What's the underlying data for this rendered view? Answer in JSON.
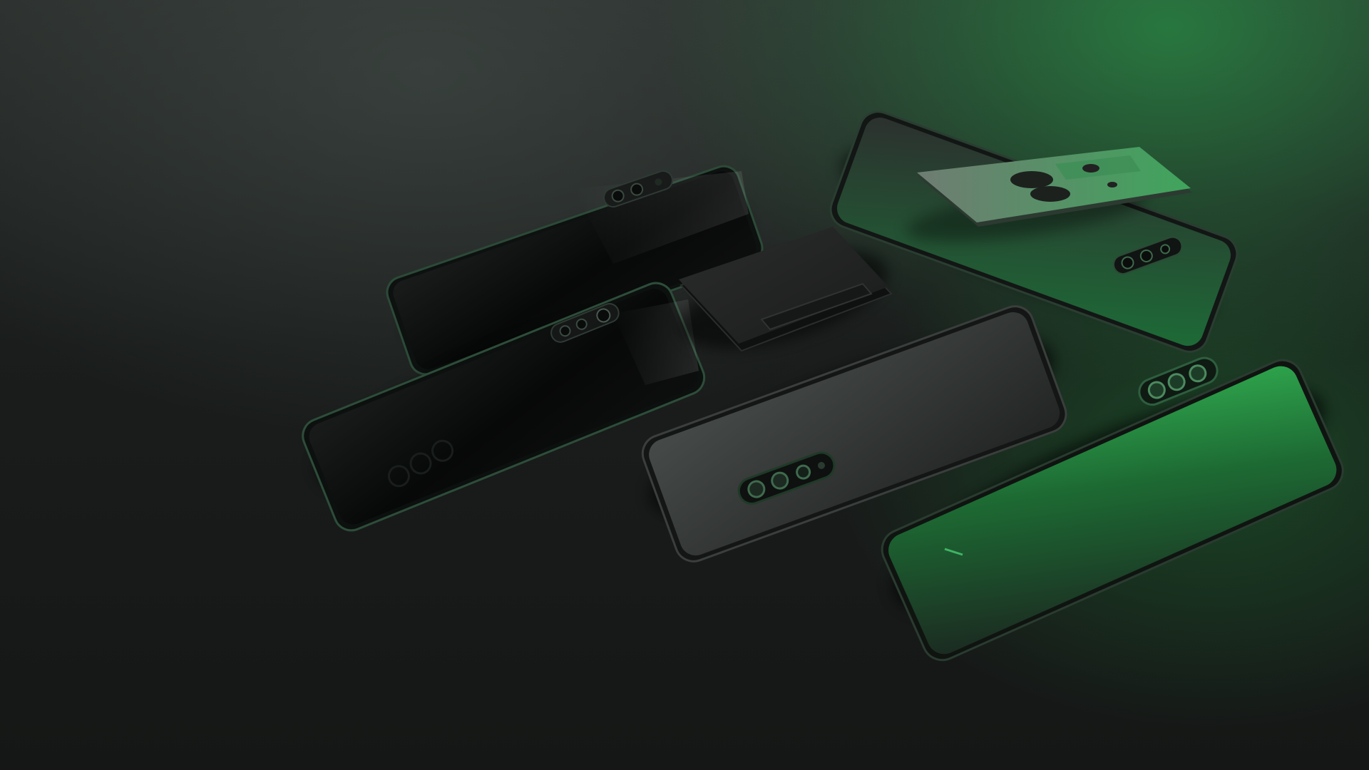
{
  "colors": {
    "background_dark": "#151716",
    "accent_green": "#2fb04f",
    "phone_black": "#0b0c0c",
    "phone_gray": "#3a3d3b",
    "phone_green": "#1f7a3a"
  },
  "scene": {
    "subject": "smartphones",
    "phone_count": 6
  }
}
